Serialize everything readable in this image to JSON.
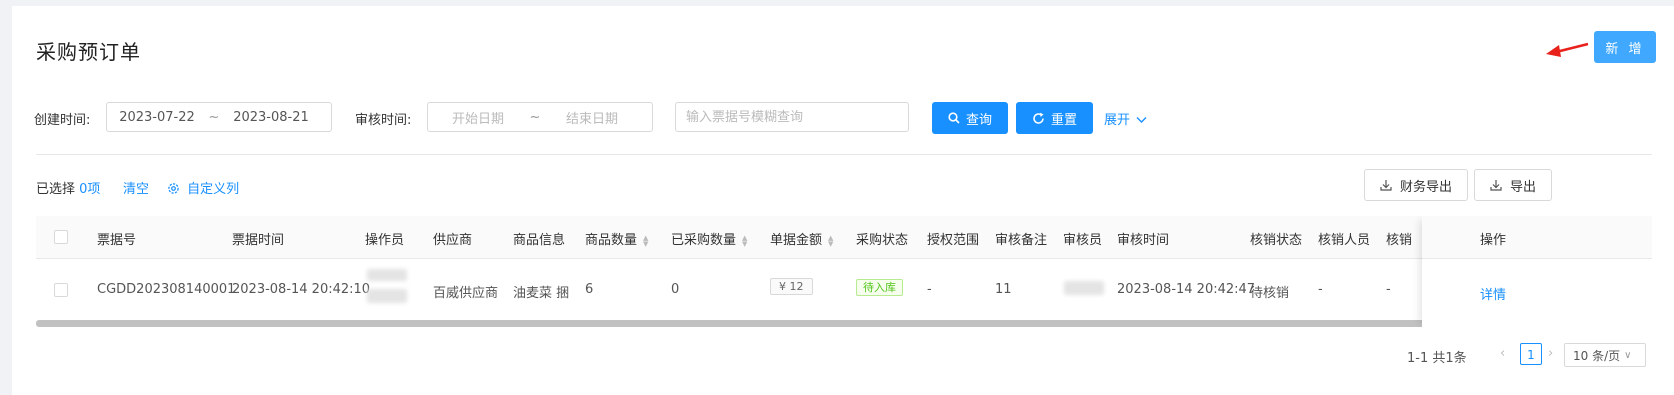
{
  "page": {
    "title": "采购预订单",
    "add_button": "新 增"
  },
  "filters": {
    "create_time_label": "创建时间:",
    "create_start": "2023-07-22",
    "create_end": "2023-08-21",
    "audit_time_label": "审核时间:",
    "audit_start_placeholder": "开始日期",
    "audit_end_placeholder": "结束日期",
    "range_separator": "~",
    "search_placeholder": "输入票据号模糊查询",
    "query_button": "查询",
    "reset_button": "重置",
    "expand_link": "展开"
  },
  "toolbar": {
    "selected_prefix": "已选择",
    "selected_count": "0项",
    "clear_link": "清空",
    "custom_columns_link": "自定义列",
    "finance_export_button": "财务导出",
    "export_button": "导出"
  },
  "table": {
    "headers": [
      "票据号",
      "票据时间",
      "操作员",
      "供应商",
      "商品信息",
      "商品数量",
      "已采购数量",
      "单据金额",
      "采购状态",
      "授权范围",
      "审核备注",
      "审核员",
      "审核时间",
      "核销状态",
      "核销人员",
      "核销",
      "操作"
    ],
    "row": {
      "bill_no": "CGDD202308140001",
      "bill_time": "2023-08-14 20:42:10",
      "supplier": "百威供应商",
      "goods_info": "油麦菜 捆",
      "goods_qty": "6",
      "purchased_qty": "0",
      "amount": "¥ 12",
      "purchase_status": "待入库",
      "auth_scope": "-",
      "audit_note": "11",
      "audit_time": "2023-08-14 20:42:47",
      "writeoff_status": "待核销",
      "writeoff_person": "-",
      "writeoff_extra": "-",
      "action": "详情"
    }
  },
  "pagination": {
    "total_text": "1-1 共1条",
    "current_page": "1",
    "page_size": "10 条/页"
  },
  "colors": {
    "primary": "#1890ff",
    "success": "#52c41a",
    "annotation_arrow": "#e8221b"
  }
}
